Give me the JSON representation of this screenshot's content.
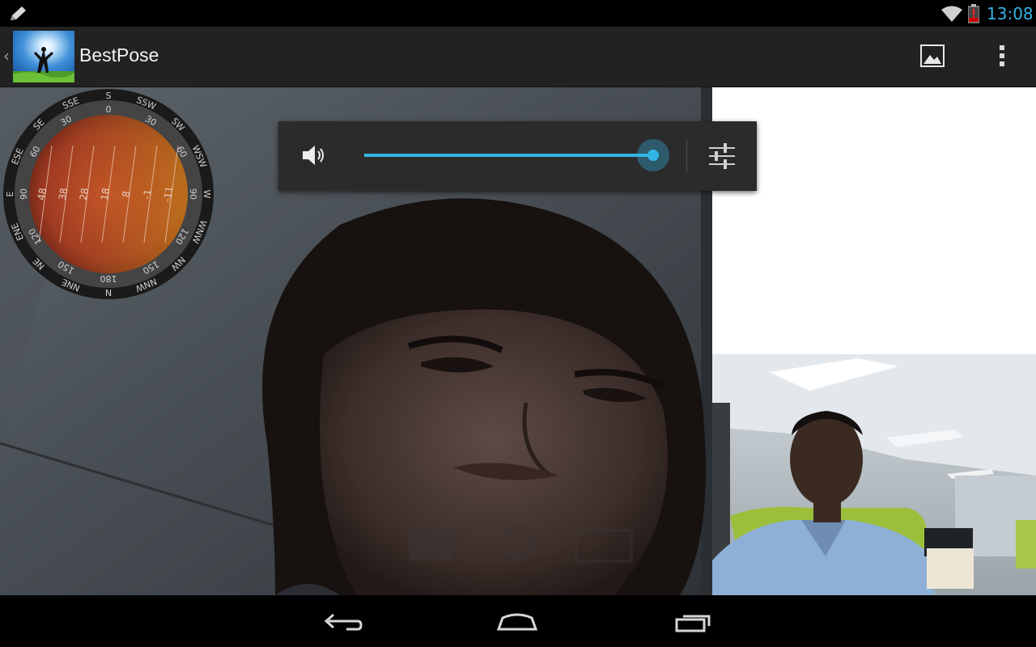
{
  "status_bar": {
    "time": "13:08",
    "icons": [
      "pencil-icon",
      "wifi-icon",
      "battery-alert-icon"
    ]
  },
  "action_bar": {
    "app_title": "BestPose",
    "icons": [
      "up-caret-icon",
      "app-logo",
      "gallery-icon",
      "overflow-menu-icon"
    ]
  },
  "compass": {
    "directions": [
      "S",
      "SSW",
      "SW",
      "WSW",
      "W",
      "WNW",
      "NW",
      "NNW",
      "N",
      "NNE",
      "NE",
      "ENE",
      "E",
      "ESE",
      "SE",
      "SSE"
    ],
    "degree_marks": [
      "0",
      "30",
      "60",
      "90",
      "120",
      "150",
      "180",
      "150",
      "120",
      "90",
      "60",
      "30"
    ],
    "scale_values": [
      "48",
      "38",
      "28",
      "18",
      "8",
      "-1",
      "-11"
    ]
  },
  "volume_panel": {
    "level_percent": 100,
    "icons": [
      "speaker-icon",
      "equalizer-settings-icon"
    ]
  },
  "nav_bar": {
    "icons": [
      "back-icon",
      "home-icon",
      "recent-apps-icon"
    ]
  },
  "colors": {
    "accent": "#33b5e5",
    "action_bar": "#222222",
    "status_bar": "#000000"
  }
}
